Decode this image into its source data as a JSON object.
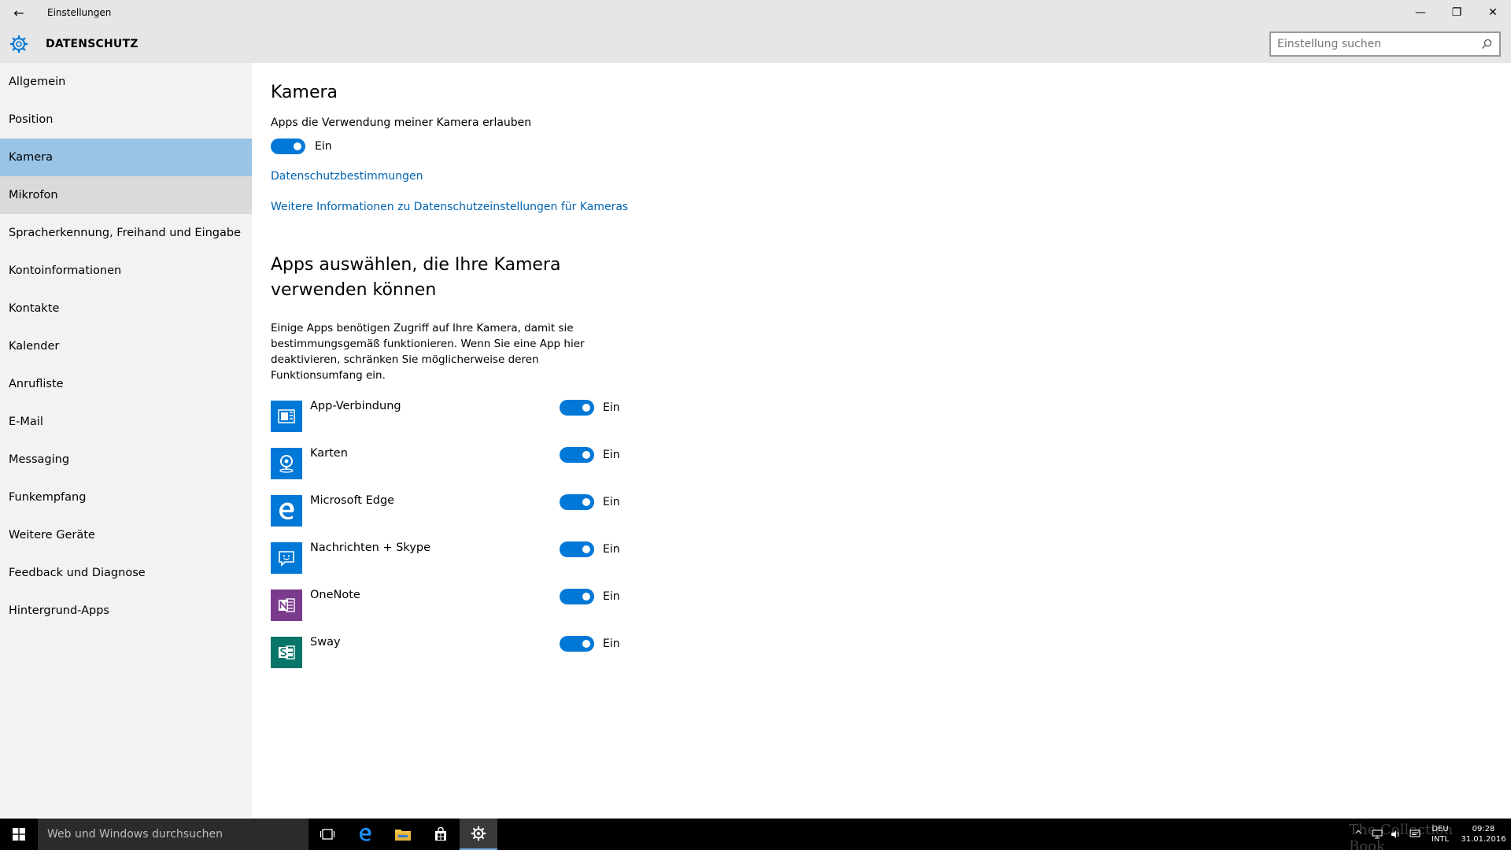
{
  "window": {
    "title": "Einstellungen",
    "back_icon": "←",
    "minimize_icon": "—",
    "restore_icon": "❐",
    "close_icon": "✕"
  },
  "header": {
    "title": "DATENSCHUTZ",
    "search_placeholder": "Einstellung suchen"
  },
  "sidebar": {
    "items": [
      {
        "label": "Allgemein"
      },
      {
        "label": "Position"
      },
      {
        "label": "Kamera",
        "state": "selected"
      },
      {
        "label": "Mikrofon",
        "state": "hover"
      },
      {
        "label": "Spracherkennung, Freihand und Eingabe"
      },
      {
        "label": "Kontoinformationen"
      },
      {
        "label": "Kontakte"
      },
      {
        "label": "Kalender"
      },
      {
        "label": "Anrufliste"
      },
      {
        "label": "E-Mail"
      },
      {
        "label": "Messaging"
      },
      {
        "label": "Funkempfang"
      },
      {
        "label": "Weitere Geräte"
      },
      {
        "label": "Feedback und Diagnose"
      },
      {
        "label": "Hintergrund-Apps"
      }
    ]
  },
  "main": {
    "title": "Kamera",
    "allow_label": "Apps die Verwendung meiner Kamera erlauben",
    "allow_toggle": "Ein",
    "link_privacy": "Datenschutzbestimmungen",
    "link_more": "Weitere Informationen zu Datenschutzeinstellungen für Kameras",
    "section_title": "Apps auswählen, die Ihre Kamera verwenden können",
    "section_desc": "Einige Apps benötigen Zugriff auf Ihre Kamera, damit sie bestimmungsgemäß funktionieren. Wenn Sie eine App hier deaktivieren, schränken Sie möglicherweise deren Funktionsumfang ein.",
    "apps": [
      {
        "name": "App-Verbindung",
        "toggle": "Ein",
        "color": "#0078d7",
        "icon": "app-connector-icon"
      },
      {
        "name": "Karten",
        "toggle": "Ein",
        "color": "#0078d7",
        "icon": "maps-icon"
      },
      {
        "name": "Microsoft Edge",
        "toggle": "Ein",
        "color": "#0078d7",
        "icon": "edge-icon"
      },
      {
        "name": "Nachrichten + Skype",
        "toggle": "Ein",
        "color": "#0078d7",
        "icon": "messaging-icon"
      },
      {
        "name": "OneNote",
        "toggle": "Ein",
        "color": "#7b3b8c",
        "icon": "onenote-icon"
      },
      {
        "name": "Sway",
        "toggle": "Ein",
        "color": "#077568",
        "icon": "sway-icon"
      }
    ]
  },
  "taskbar": {
    "search_text": "Web und Windows durchsuchen",
    "lang_1": "DEU",
    "lang_2": "INTL",
    "time": "09:28",
    "date": "31.01.2016",
    "watermark": "The Collection Book"
  },
  "colors": {
    "accent": "#0078d7",
    "selected_nav": "#99c4e6",
    "link": "#0063b1"
  }
}
